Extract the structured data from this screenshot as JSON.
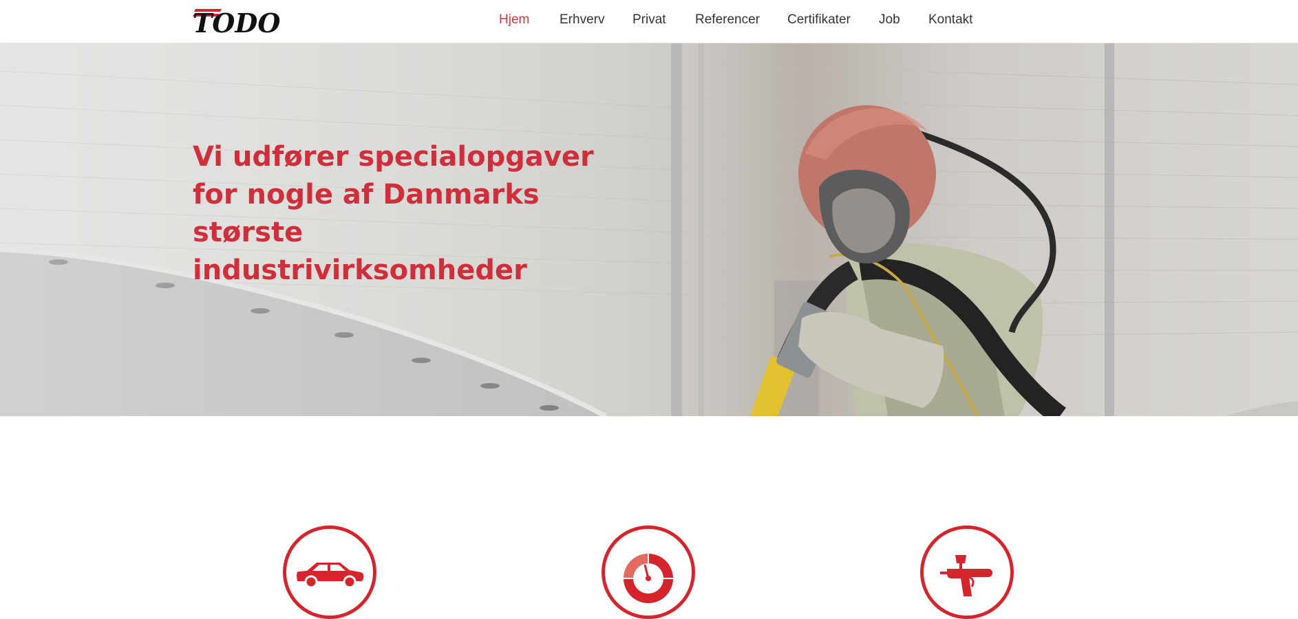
{
  "logo": {
    "text": "TODO",
    "icon": "todo-logo",
    "accent_color": "#d4252d"
  },
  "nav": {
    "items": [
      {
        "label": "Hjem",
        "active": true
      },
      {
        "label": "Erhverv",
        "active": false
      },
      {
        "label": "Privat",
        "active": false
      },
      {
        "label": "Referencer",
        "active": false
      },
      {
        "label": "Certifikater",
        "active": false
      },
      {
        "label": "Job",
        "active": false
      },
      {
        "label": "Kontakt",
        "active": false
      }
    ],
    "active_color": "#c63a3f",
    "text_color": "#333333"
  },
  "hero": {
    "headline_lines": [
      "Vi udfører specialopgaver",
      "for nogle af Danmarks",
      "største",
      "industrivirksomheder"
    ],
    "headline_color": "#cf2f3b",
    "image": "worker-in-blasting-helmet-photo"
  },
  "services": [
    {
      "icon": "car-icon"
    },
    {
      "icon": "gauge-icon"
    },
    {
      "icon": "spray-gun-icon"
    }
  ],
  "brand_red": "#d4252d"
}
